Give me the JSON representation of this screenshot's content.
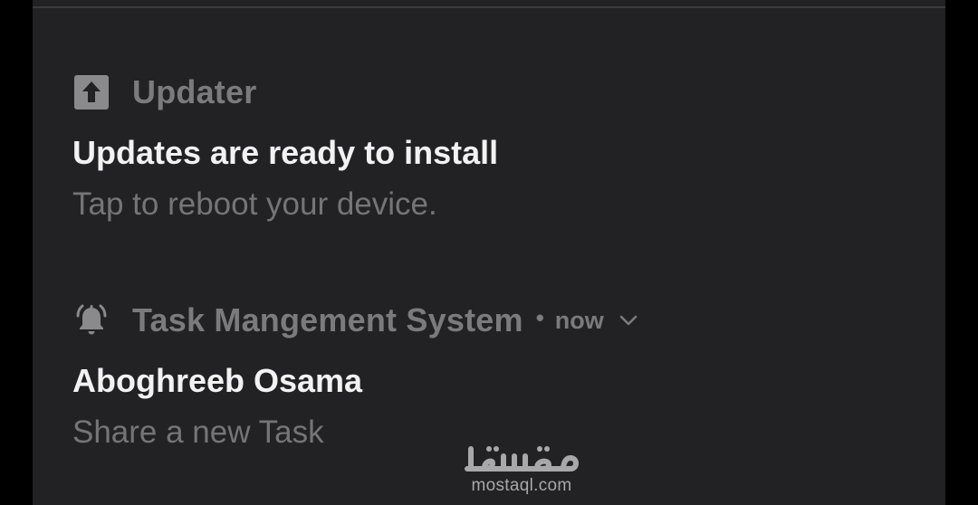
{
  "notifications": [
    {
      "app_name": "Updater",
      "icon": "upload-arrow-icon",
      "title": "Updates are ready to install",
      "body": "Tap to reboot your device."
    },
    {
      "app_name": "Task Mangement System",
      "icon": "bell-icon",
      "separator": "•",
      "time": "now",
      "expand_icon": "chevron-down-icon",
      "title": "Aboghreeb Osama",
      "body": "Share a new Task"
    }
  ],
  "watermark": {
    "text": "mostaql.com",
    "logo_text": "مستقل"
  },
  "colors": {
    "background": "#000000",
    "panel": "#222224",
    "app_name": "#7b7b7e",
    "title": "#f2f2f2",
    "body": "#757578"
  }
}
